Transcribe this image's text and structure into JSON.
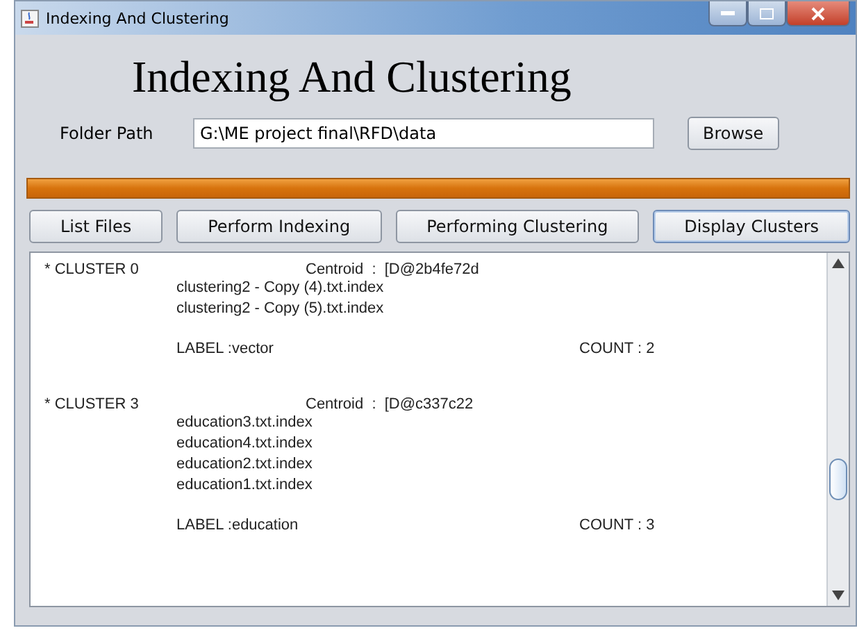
{
  "window": {
    "title": "Indexing And Clustering"
  },
  "heading": "Indexing And Clustering",
  "folder": {
    "label": "Folder Path",
    "value": "G:\\ME project final\\RFD\\data",
    "button": "Browse"
  },
  "progress": {
    "level": 1
  },
  "actions": [
    {
      "label": "List Files",
      "selected": false
    },
    {
      "label": "Perform Indexing",
      "selected": false
    },
    {
      "label": "Performing Clustering",
      "selected": false
    },
    {
      "label": "Display Clusters",
      "selected": true
    }
  ],
  "clusters": [
    {
      "name": "* CLUSTER 0",
      "centroid": "Centroid  :  [D@2b4fe72d",
      "files": [
        "clustering2 - Copy (4).txt.index",
        "clustering2 - Copy (5).txt.index"
      ],
      "label": "LABEL :vector",
      "count": "COUNT : 2"
    },
    {
      "name": "* CLUSTER 3",
      "centroid": "Centroid  :  [D@c337c22",
      "files": [
        "education3.txt.index",
        "education4.txt.index",
        "education2.txt.index",
        "education1.txt.index"
      ],
      "label": "LABEL :education",
      "count": "COUNT : 3"
    }
  ]
}
